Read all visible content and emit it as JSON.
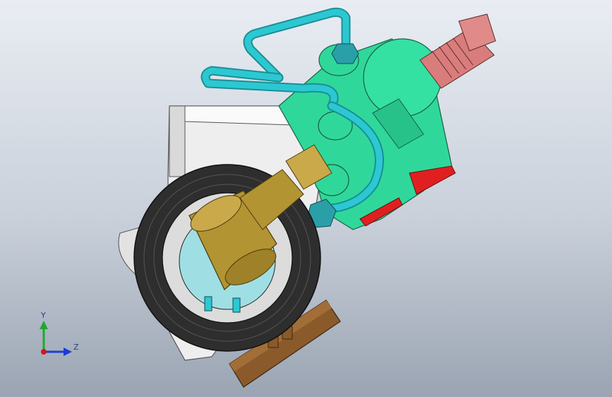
{
  "viewport": {
    "background_top": "#e9edf3",
    "background_bottom": "#9aa4b2"
  },
  "triad": {
    "y_label": "Y",
    "z_label": "Z",
    "y_color": "#1fa82d",
    "z_color": "#1c3cd6",
    "x_color": "#d01818"
  },
  "model": {
    "parts": [
      {
        "name": "tire",
        "color": "#2a2a2a",
        "icon": "tire-icon"
      },
      {
        "name": "brass-fitting",
        "color": "#b39432",
        "icon": "valve-icon"
      },
      {
        "name": "green-valve-body",
        "color": "#2fd89a",
        "icon": "valve-body-icon"
      },
      {
        "name": "cyan-tubing",
        "color": "#24bfc9",
        "icon": "pipe-icon"
      },
      {
        "name": "pink-connector",
        "color": "#d97c7c",
        "icon": "connector-icon"
      },
      {
        "name": "white-bracket",
        "color": "#f2f2f2",
        "icon": "bracket-icon"
      },
      {
        "name": "brown-base-plate",
        "color": "#8a5a2b",
        "icon": "plate-icon"
      }
    ]
  }
}
